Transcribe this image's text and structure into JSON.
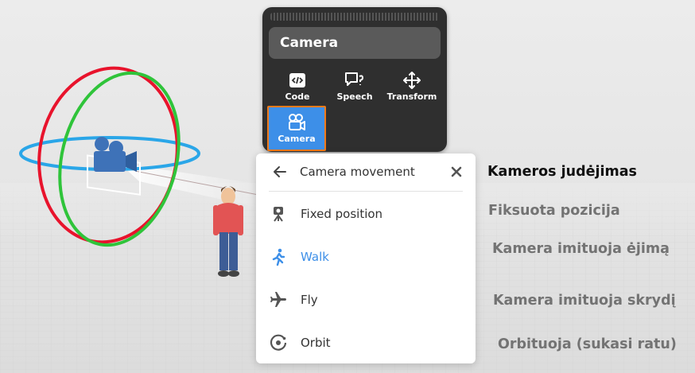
{
  "panel": {
    "title": "Camera",
    "tools": [
      {
        "label": "Code",
        "icon": "code-icon"
      },
      {
        "label": "Speech",
        "icon": "speech-bubble-icon"
      },
      {
        "label": "Transform",
        "icon": "move-arrows-icon"
      },
      {
        "label": "Camera",
        "icon": "video-camera-icon"
      }
    ]
  },
  "menu": {
    "title": "Camera movement",
    "items": [
      {
        "label": "Fixed position",
        "icon": "tripod-camera-icon",
        "active": false
      },
      {
        "label": "Walk",
        "icon": "walking-person-icon",
        "active": true
      },
      {
        "label": "Fly",
        "icon": "airplane-icon",
        "active": false
      },
      {
        "label": "Orbit",
        "icon": "orbit-icon",
        "active": false
      }
    ]
  },
  "annotations": {
    "heading": "Kameros judėjimas",
    "fixed": "Fiksuota pozicija",
    "walk": "Kamera imituoja ėjimą",
    "fly": "Kamera imituoja skrydį",
    "orbit": "Orbituoja (sukasi ratu)"
  },
  "colors": {
    "accent": "#3d8fe8",
    "highlight_border": "#f07a1a",
    "panel_bg": "#2f2f2f",
    "gizmo_x": "#e8132c",
    "gizmo_y": "#2fc43a",
    "gizmo_z": "#2aa6e8"
  }
}
